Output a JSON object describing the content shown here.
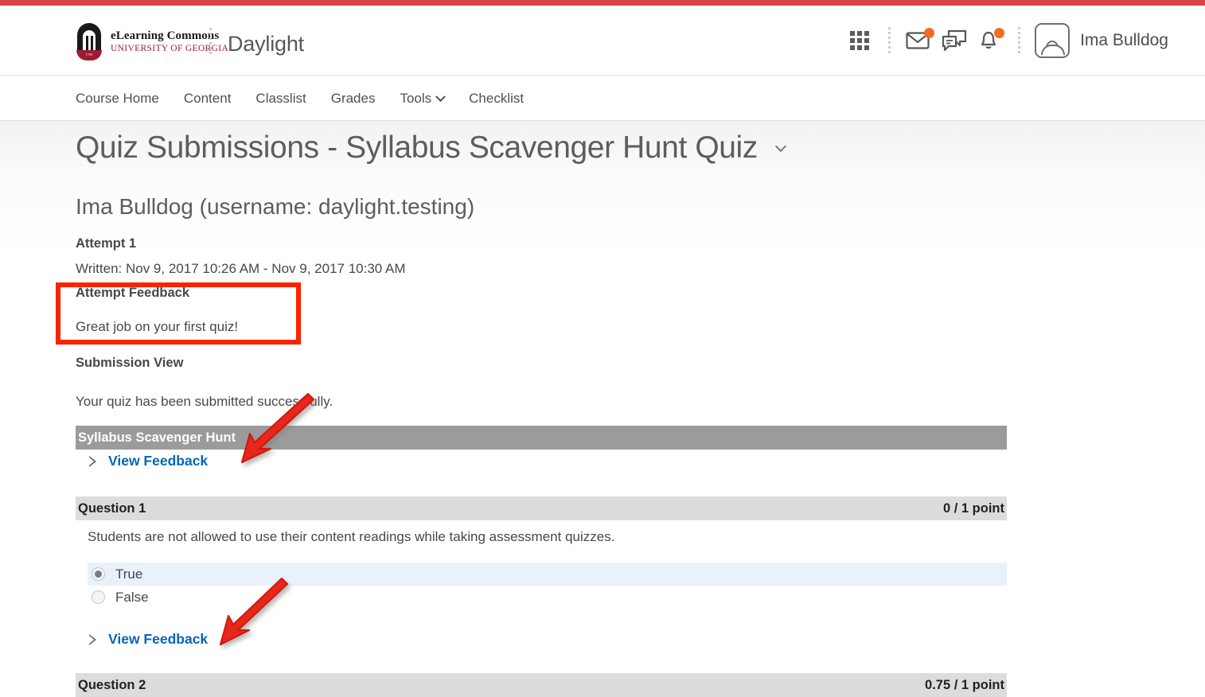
{
  "brand": {
    "logo_icon": "uga-arch-logo-icon",
    "line1": "eLearning Commons",
    "line2": "UNIVERSITY OF GEORGIA",
    "seal_year": "1785",
    "app_title": "Daylight"
  },
  "header": {
    "icons": [
      {
        "name": "waffle-menu-icon",
        "label": "Course Selector"
      },
      {
        "name": "message-envelope-icon",
        "label": "Messages",
        "badge": true
      },
      {
        "name": "chat-bubbles-icon",
        "label": "Subscriptions",
        "badge": false
      },
      {
        "name": "notification-bell-icon",
        "label": "Notifications",
        "badge": true
      }
    ],
    "user_name": "Ima Bulldog",
    "avatar_icon": "user-avatar-icon"
  },
  "nav": {
    "items": [
      {
        "label": "Course Home",
        "has_caret": false
      },
      {
        "label": "Content",
        "has_caret": false
      },
      {
        "label": "Classlist",
        "has_caret": false
      },
      {
        "label": "Grades",
        "has_caret": false
      },
      {
        "label": "Tools",
        "has_caret": true
      },
      {
        "label": "Checklist",
        "has_caret": false
      }
    ]
  },
  "page": {
    "title": "Quiz Submissions - Syllabus Scavenger Hunt Quiz",
    "title_caret_icon": "chevron-down-icon",
    "subject": "Ima Bulldog (username: daylight.testing)",
    "attempt_label": "Attempt 1",
    "written_line": "Written: Nov 9, 2017 10:26 AM - Nov 9, 2017 10:30 AM",
    "attempt_feedback_label": "Attempt Feedback",
    "attempt_feedback_text": "Great job on your first quiz!",
    "submission_view_label": "Submission View",
    "submission_view_text": "Your quiz has been submitted successfully.",
    "quiz_bar_title": "Syllabus Scavenger Hunt",
    "quiz_view_feedback": "View Feedback"
  },
  "questions": [
    {
      "name": "Question 1",
      "points": "0 / 1 point",
      "text": "Students are not allowed to use their content readings while taking assessment quizzes.",
      "options": [
        {
          "label": "True",
          "selected": true
        },
        {
          "label": "False",
          "selected": false
        }
      ],
      "view_feedback": "View Feedback"
    },
    {
      "name": "Question 2",
      "points": "0.75 / 1 point"
    }
  ],
  "colors": {
    "top_accent": "#d6444a",
    "brand_red": "#9e1b32",
    "link_blue": "#0566b5",
    "annotation_red": "#fa2300",
    "badge_orange": "#f26b21",
    "quiz_bar_gray": "#9b9b9b",
    "question_bar_gray": "#dcdcdc",
    "selected_option_blue": "#e9f1fa"
  },
  "annotations": {
    "highlight_box": "attempt-feedback-highlight",
    "arrows": [
      {
        "name": "arrow-pointing-to-quiz-view-feedback"
      },
      {
        "name": "arrow-pointing-to-question1-view-feedback"
      }
    ]
  }
}
